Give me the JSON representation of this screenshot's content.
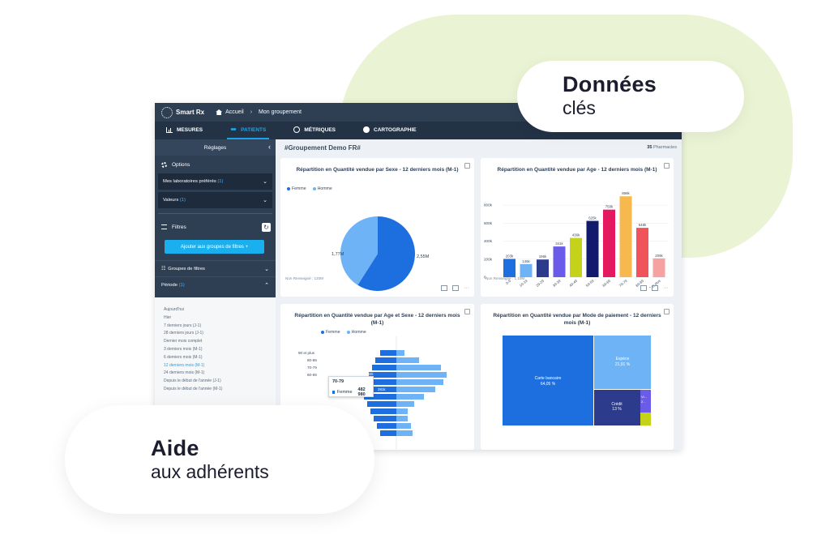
{
  "app": {
    "logo": "Smart Rx",
    "breadcrumb": {
      "home": "Accueil",
      "current": "Mon groupement"
    },
    "tabs": [
      "MESURES",
      "PATIENTS",
      "MÉTRIQUES",
      "CARTOGRAPHIE"
    ],
    "active_tab": "PATIENTS"
  },
  "sidebar": {
    "title": "Réglages",
    "options_label": "Options",
    "labs": {
      "label": "Mes laboratoires préférés",
      "count": "(1)"
    },
    "values": {
      "label": "Valeurs",
      "count": "(1)"
    },
    "filters_label": "Filtres",
    "add_button": "Ajouter aux groupes de filtres",
    "groups_label": "Groupes de filtres",
    "period": {
      "label": "Période",
      "count": "(1)"
    },
    "period_items": [
      "Aujourd'hui",
      "Hier",
      "7 derniers jours (J-1)",
      "28 derniers jours (J-1)",
      "Dernier mois complet",
      "3 derniers mois (M-1)",
      "6 derniers mois (M-1)",
      "12 derniers mois (M-1)",
      "24 derniers mois (M-1)",
      "Depuis le début de l'année (J-1)",
      "Depuis le début de l'année (M-1)"
    ],
    "period_active_index": 7
  },
  "content": {
    "group_title": "#Groupement Demo FR#",
    "pharmacies_count": "35",
    "pharmacies_label": "Pharmacies"
  },
  "colors": {
    "femme": "#1d6fe0",
    "homme": "#6fb3f7",
    "accent": "#1aa3e8"
  },
  "chart_data": [
    {
      "type": "pie",
      "title": "Répartition en Quantité vendue par Sexe - 12 derniers mois (M-1)",
      "legend": [
        "Femme",
        "Homme"
      ],
      "slices": [
        {
          "name": "Femme",
          "label": "2,55M",
          "value": 2.55
        },
        {
          "name": "Homme",
          "label": "1,77M",
          "value": 1.77
        }
      ],
      "footnote": "Non Renseigné : 120M"
    },
    {
      "type": "bar",
      "title": "Répartition en Quantité vendue par Age - 12 derniers mois (M-1)",
      "categories": [
        "0-9",
        "10-19",
        "20-29",
        "30-39",
        "40-49",
        "50-59",
        "60-69",
        "70-79",
        "80-89",
        "90 et plus"
      ],
      "values": [
        203,
        146,
        196,
        341,
        436,
        625,
        750,
        898,
        548,
        209
      ],
      "labels": [
        "203k",
        "146k",
        "196k",
        "341k",
        "436k",
        "625k",
        "750k",
        "898k",
        "548k",
        "209k"
      ],
      "bar_colors": [
        "#1d6fe0",
        "#6fb3f7",
        "#2c3b8c",
        "#6a5ce8",
        "#c5d21a",
        "#121a6d",
        "#e5195f",
        "#f7b84d",
        "#f0545a",
        "#f6a2a2"
      ],
      "yticks": [
        "0",
        "200k",
        "400k",
        "600k",
        "800k"
      ],
      "ylim": [
        0,
        900
      ],
      "footnote": "Non Renseigné : 1,10M"
    },
    {
      "type": "bar",
      "title": "Répartition en Quantité vendue par Age et Sexe - 12 derniers mois (M-1)",
      "legend": [
        "Femme",
        "Homme"
      ],
      "categories": [
        "90 et plus",
        "80-89",
        "70-79",
        "60-69"
      ],
      "tooltip": {
        "category": "70-79",
        "series": "Femme",
        "value": "482 980"
      },
      "bar_labels": [
        "482k",
        "391k"
      ]
    },
    {
      "type": "heatmap",
      "title": "Répartition en Quantité vendue par Mode de paiement - 12 derniers mois (M-1)",
      "cells": [
        {
          "name": "Carte bancaire",
          "percent": "64,05 %"
        },
        {
          "name": "Espèce",
          "percent": "21,91 %"
        },
        {
          "name": "Crédit",
          "percent": "13 %"
        },
        {
          "name": "Vi...",
          "percent": "2..."
        }
      ]
    }
  ],
  "captions": {
    "right": {
      "strong": "Données",
      "light": "clés"
    },
    "left": {
      "strong": "Aide",
      "light": "aux adhérents"
    }
  }
}
